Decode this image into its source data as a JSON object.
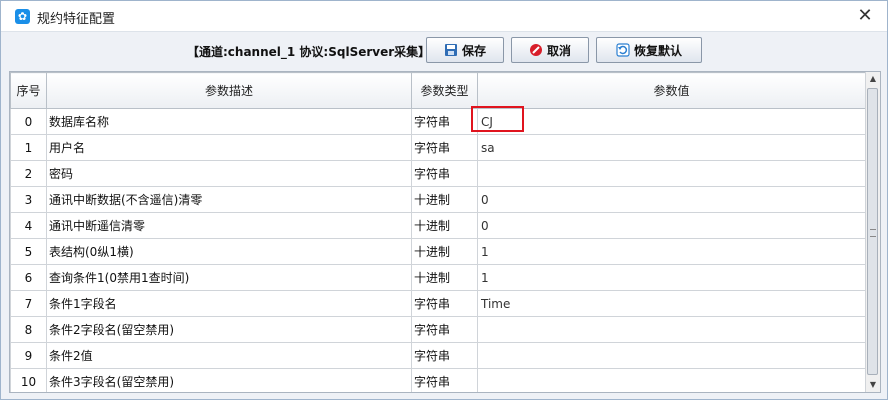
{
  "window": {
    "title": "规约特征配置",
    "close_label": "✕"
  },
  "toolbar": {
    "channel_info": "【通道:channel_1  协议:SqlServer采集】",
    "save_label": "保存",
    "cancel_label": "取消",
    "reset_label": "恢复默认"
  },
  "table": {
    "headers": [
      "序号",
      "参数描述",
      "参数类型",
      "参数值"
    ],
    "rows": [
      {
        "idx": "0",
        "desc": "数据库名称",
        "type": "字符串",
        "value": "CJ"
      },
      {
        "idx": "1",
        "desc": "用户名",
        "type": "字符串",
        "value": "sa"
      },
      {
        "idx": "2",
        "desc": "密码",
        "type": "字符串",
        "value": ""
      },
      {
        "idx": "3",
        "desc": "通讯中断数据(不含遥信)清零",
        "type": "十进制",
        "value": "0"
      },
      {
        "idx": "4",
        "desc": "通讯中断遥信清零",
        "type": "十进制",
        "value": "0"
      },
      {
        "idx": "5",
        "desc": "表结构(0纵1横)",
        "type": "十进制",
        "value": "1"
      },
      {
        "idx": "6",
        "desc": "查询条件1(0禁用1查时间)",
        "type": "十进制",
        "value": "1"
      },
      {
        "idx": "7",
        "desc": "条件1字段名",
        "type": "字符串",
        "value": "Time"
      },
      {
        "idx": "8",
        "desc": "条件2字段名(留空禁用)",
        "type": "字符串",
        "value": ""
      },
      {
        "idx": "9",
        "desc": "条件2值",
        "type": "字符串",
        "value": ""
      },
      {
        "idx": "10",
        "desc": "条件3字段名(留空禁用)",
        "type": "字符串",
        "value": ""
      }
    ]
  },
  "icons": {
    "app": "settings-icon",
    "save": "floppy-disk-icon",
    "cancel": "cancel-icon",
    "reset": "restore-icon"
  },
  "colors": {
    "highlight": "#e0141e",
    "app_icon": "#1a8fe8"
  }
}
